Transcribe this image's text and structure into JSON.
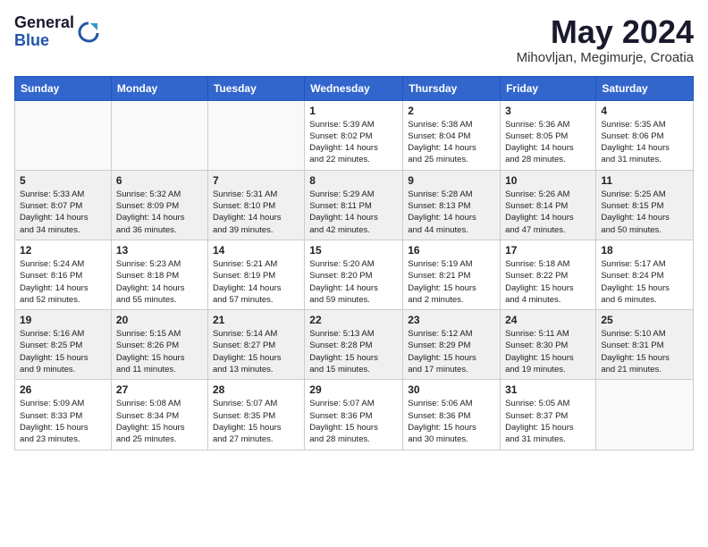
{
  "logo": {
    "general": "General",
    "blue": "Blue"
  },
  "title": "May 2024",
  "location": "Mihovljan, Megimurje, Croatia",
  "days_of_week": [
    "Sunday",
    "Monday",
    "Tuesday",
    "Wednesday",
    "Thursday",
    "Friday",
    "Saturday"
  ],
  "weeks": [
    [
      {
        "day": "",
        "info": ""
      },
      {
        "day": "",
        "info": ""
      },
      {
        "day": "",
        "info": ""
      },
      {
        "day": "1",
        "info": "Sunrise: 5:39 AM\nSunset: 8:02 PM\nDaylight: 14 hours\nand 22 minutes."
      },
      {
        "day": "2",
        "info": "Sunrise: 5:38 AM\nSunset: 8:04 PM\nDaylight: 14 hours\nand 25 minutes."
      },
      {
        "day": "3",
        "info": "Sunrise: 5:36 AM\nSunset: 8:05 PM\nDaylight: 14 hours\nand 28 minutes."
      },
      {
        "day": "4",
        "info": "Sunrise: 5:35 AM\nSunset: 8:06 PM\nDaylight: 14 hours\nand 31 minutes."
      }
    ],
    [
      {
        "day": "5",
        "info": "Sunrise: 5:33 AM\nSunset: 8:07 PM\nDaylight: 14 hours\nand 34 minutes."
      },
      {
        "day": "6",
        "info": "Sunrise: 5:32 AM\nSunset: 8:09 PM\nDaylight: 14 hours\nand 36 minutes."
      },
      {
        "day": "7",
        "info": "Sunrise: 5:31 AM\nSunset: 8:10 PM\nDaylight: 14 hours\nand 39 minutes."
      },
      {
        "day": "8",
        "info": "Sunrise: 5:29 AM\nSunset: 8:11 PM\nDaylight: 14 hours\nand 42 minutes."
      },
      {
        "day": "9",
        "info": "Sunrise: 5:28 AM\nSunset: 8:13 PM\nDaylight: 14 hours\nand 44 minutes."
      },
      {
        "day": "10",
        "info": "Sunrise: 5:26 AM\nSunset: 8:14 PM\nDaylight: 14 hours\nand 47 minutes."
      },
      {
        "day": "11",
        "info": "Sunrise: 5:25 AM\nSunset: 8:15 PM\nDaylight: 14 hours\nand 50 minutes."
      }
    ],
    [
      {
        "day": "12",
        "info": "Sunrise: 5:24 AM\nSunset: 8:16 PM\nDaylight: 14 hours\nand 52 minutes."
      },
      {
        "day": "13",
        "info": "Sunrise: 5:23 AM\nSunset: 8:18 PM\nDaylight: 14 hours\nand 55 minutes."
      },
      {
        "day": "14",
        "info": "Sunrise: 5:21 AM\nSunset: 8:19 PM\nDaylight: 14 hours\nand 57 minutes."
      },
      {
        "day": "15",
        "info": "Sunrise: 5:20 AM\nSunset: 8:20 PM\nDaylight: 14 hours\nand 59 minutes."
      },
      {
        "day": "16",
        "info": "Sunrise: 5:19 AM\nSunset: 8:21 PM\nDaylight: 15 hours\nand 2 minutes."
      },
      {
        "day": "17",
        "info": "Sunrise: 5:18 AM\nSunset: 8:22 PM\nDaylight: 15 hours\nand 4 minutes."
      },
      {
        "day": "18",
        "info": "Sunrise: 5:17 AM\nSunset: 8:24 PM\nDaylight: 15 hours\nand 6 minutes."
      }
    ],
    [
      {
        "day": "19",
        "info": "Sunrise: 5:16 AM\nSunset: 8:25 PM\nDaylight: 15 hours\nand 9 minutes."
      },
      {
        "day": "20",
        "info": "Sunrise: 5:15 AM\nSunset: 8:26 PM\nDaylight: 15 hours\nand 11 minutes."
      },
      {
        "day": "21",
        "info": "Sunrise: 5:14 AM\nSunset: 8:27 PM\nDaylight: 15 hours\nand 13 minutes."
      },
      {
        "day": "22",
        "info": "Sunrise: 5:13 AM\nSunset: 8:28 PM\nDaylight: 15 hours\nand 15 minutes."
      },
      {
        "day": "23",
        "info": "Sunrise: 5:12 AM\nSunset: 8:29 PM\nDaylight: 15 hours\nand 17 minutes."
      },
      {
        "day": "24",
        "info": "Sunrise: 5:11 AM\nSunset: 8:30 PM\nDaylight: 15 hours\nand 19 minutes."
      },
      {
        "day": "25",
        "info": "Sunrise: 5:10 AM\nSunset: 8:31 PM\nDaylight: 15 hours\nand 21 minutes."
      }
    ],
    [
      {
        "day": "26",
        "info": "Sunrise: 5:09 AM\nSunset: 8:33 PM\nDaylight: 15 hours\nand 23 minutes."
      },
      {
        "day": "27",
        "info": "Sunrise: 5:08 AM\nSunset: 8:34 PM\nDaylight: 15 hours\nand 25 minutes."
      },
      {
        "day": "28",
        "info": "Sunrise: 5:07 AM\nSunset: 8:35 PM\nDaylight: 15 hours\nand 27 minutes."
      },
      {
        "day": "29",
        "info": "Sunrise: 5:07 AM\nSunset: 8:36 PM\nDaylight: 15 hours\nand 28 minutes."
      },
      {
        "day": "30",
        "info": "Sunrise: 5:06 AM\nSunset: 8:36 PM\nDaylight: 15 hours\nand 30 minutes."
      },
      {
        "day": "31",
        "info": "Sunrise: 5:05 AM\nSunset: 8:37 PM\nDaylight: 15 hours\nand 31 minutes."
      },
      {
        "day": "",
        "info": ""
      }
    ]
  ]
}
